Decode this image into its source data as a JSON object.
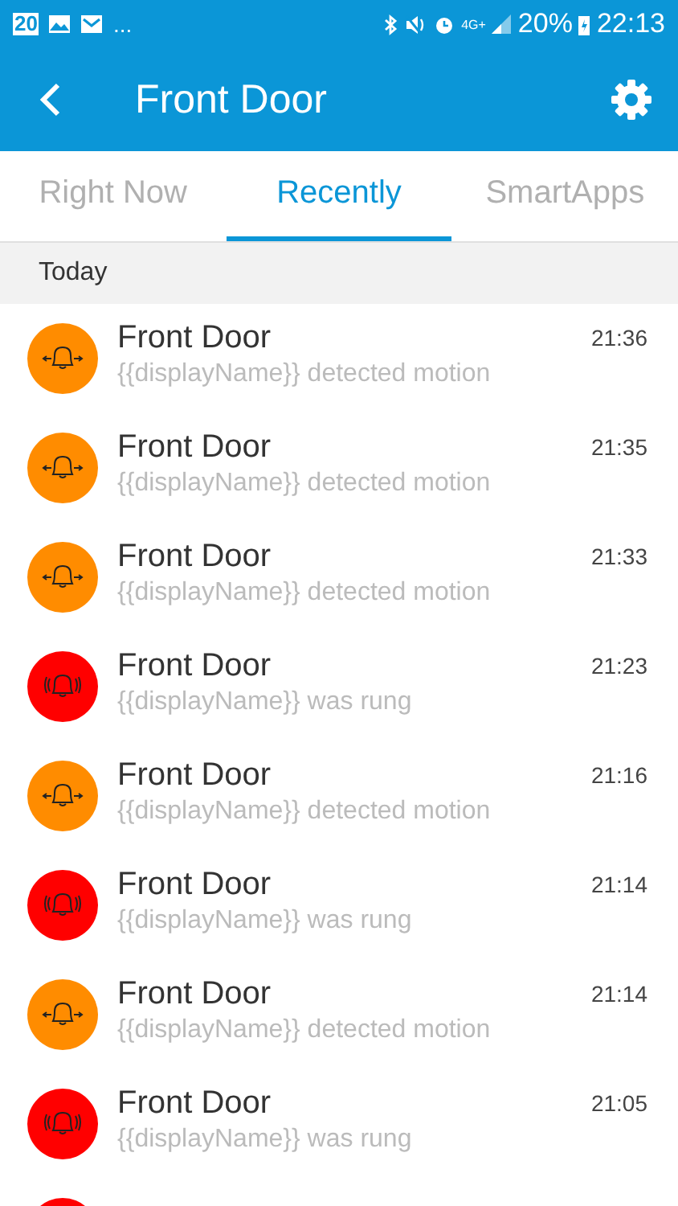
{
  "status_bar": {
    "calendar_day": "20",
    "more": "...",
    "network": "4G+",
    "battery": "20%",
    "time": "22:13"
  },
  "header": {
    "title": "Front Door"
  },
  "tabs": [
    {
      "label": "Right Now",
      "selected": false
    },
    {
      "label": "Recently",
      "selected": true
    },
    {
      "label": "SmartApps",
      "selected": false
    }
  ],
  "section": "Today",
  "events": [
    {
      "kind": "motion",
      "color": "#ff8c00",
      "title": "Front Door",
      "detail": "{{displayName}} detected motion",
      "time": "21:36"
    },
    {
      "kind": "motion",
      "color": "#ff8c00",
      "title": "Front Door",
      "detail": "{{displayName}} detected motion",
      "time": "21:35"
    },
    {
      "kind": "motion",
      "color": "#ff8c00",
      "title": "Front Door",
      "detail": "{{displayName}} detected motion",
      "time": "21:33"
    },
    {
      "kind": "ring",
      "color": "#ff0000",
      "title": "Front Door",
      "detail": "{{displayName}} was rung",
      "time": "21:23"
    },
    {
      "kind": "motion",
      "color": "#ff8c00",
      "title": "Front Door",
      "detail": "{{displayName}} detected motion",
      "time": "21:16"
    },
    {
      "kind": "ring",
      "color": "#ff0000",
      "title": "Front Door",
      "detail": "{{displayName}} was rung",
      "time": "21:14"
    },
    {
      "kind": "motion",
      "color": "#ff8c00",
      "title": "Front Door",
      "detail": "{{displayName}} detected motion",
      "time": "21:14"
    },
    {
      "kind": "ring",
      "color": "#ff0000",
      "title": "Front Door",
      "detail": "{{displayName}} was rung",
      "time": "21:05"
    },
    {
      "kind": "ring",
      "color": "#ff0000"
    }
  ]
}
